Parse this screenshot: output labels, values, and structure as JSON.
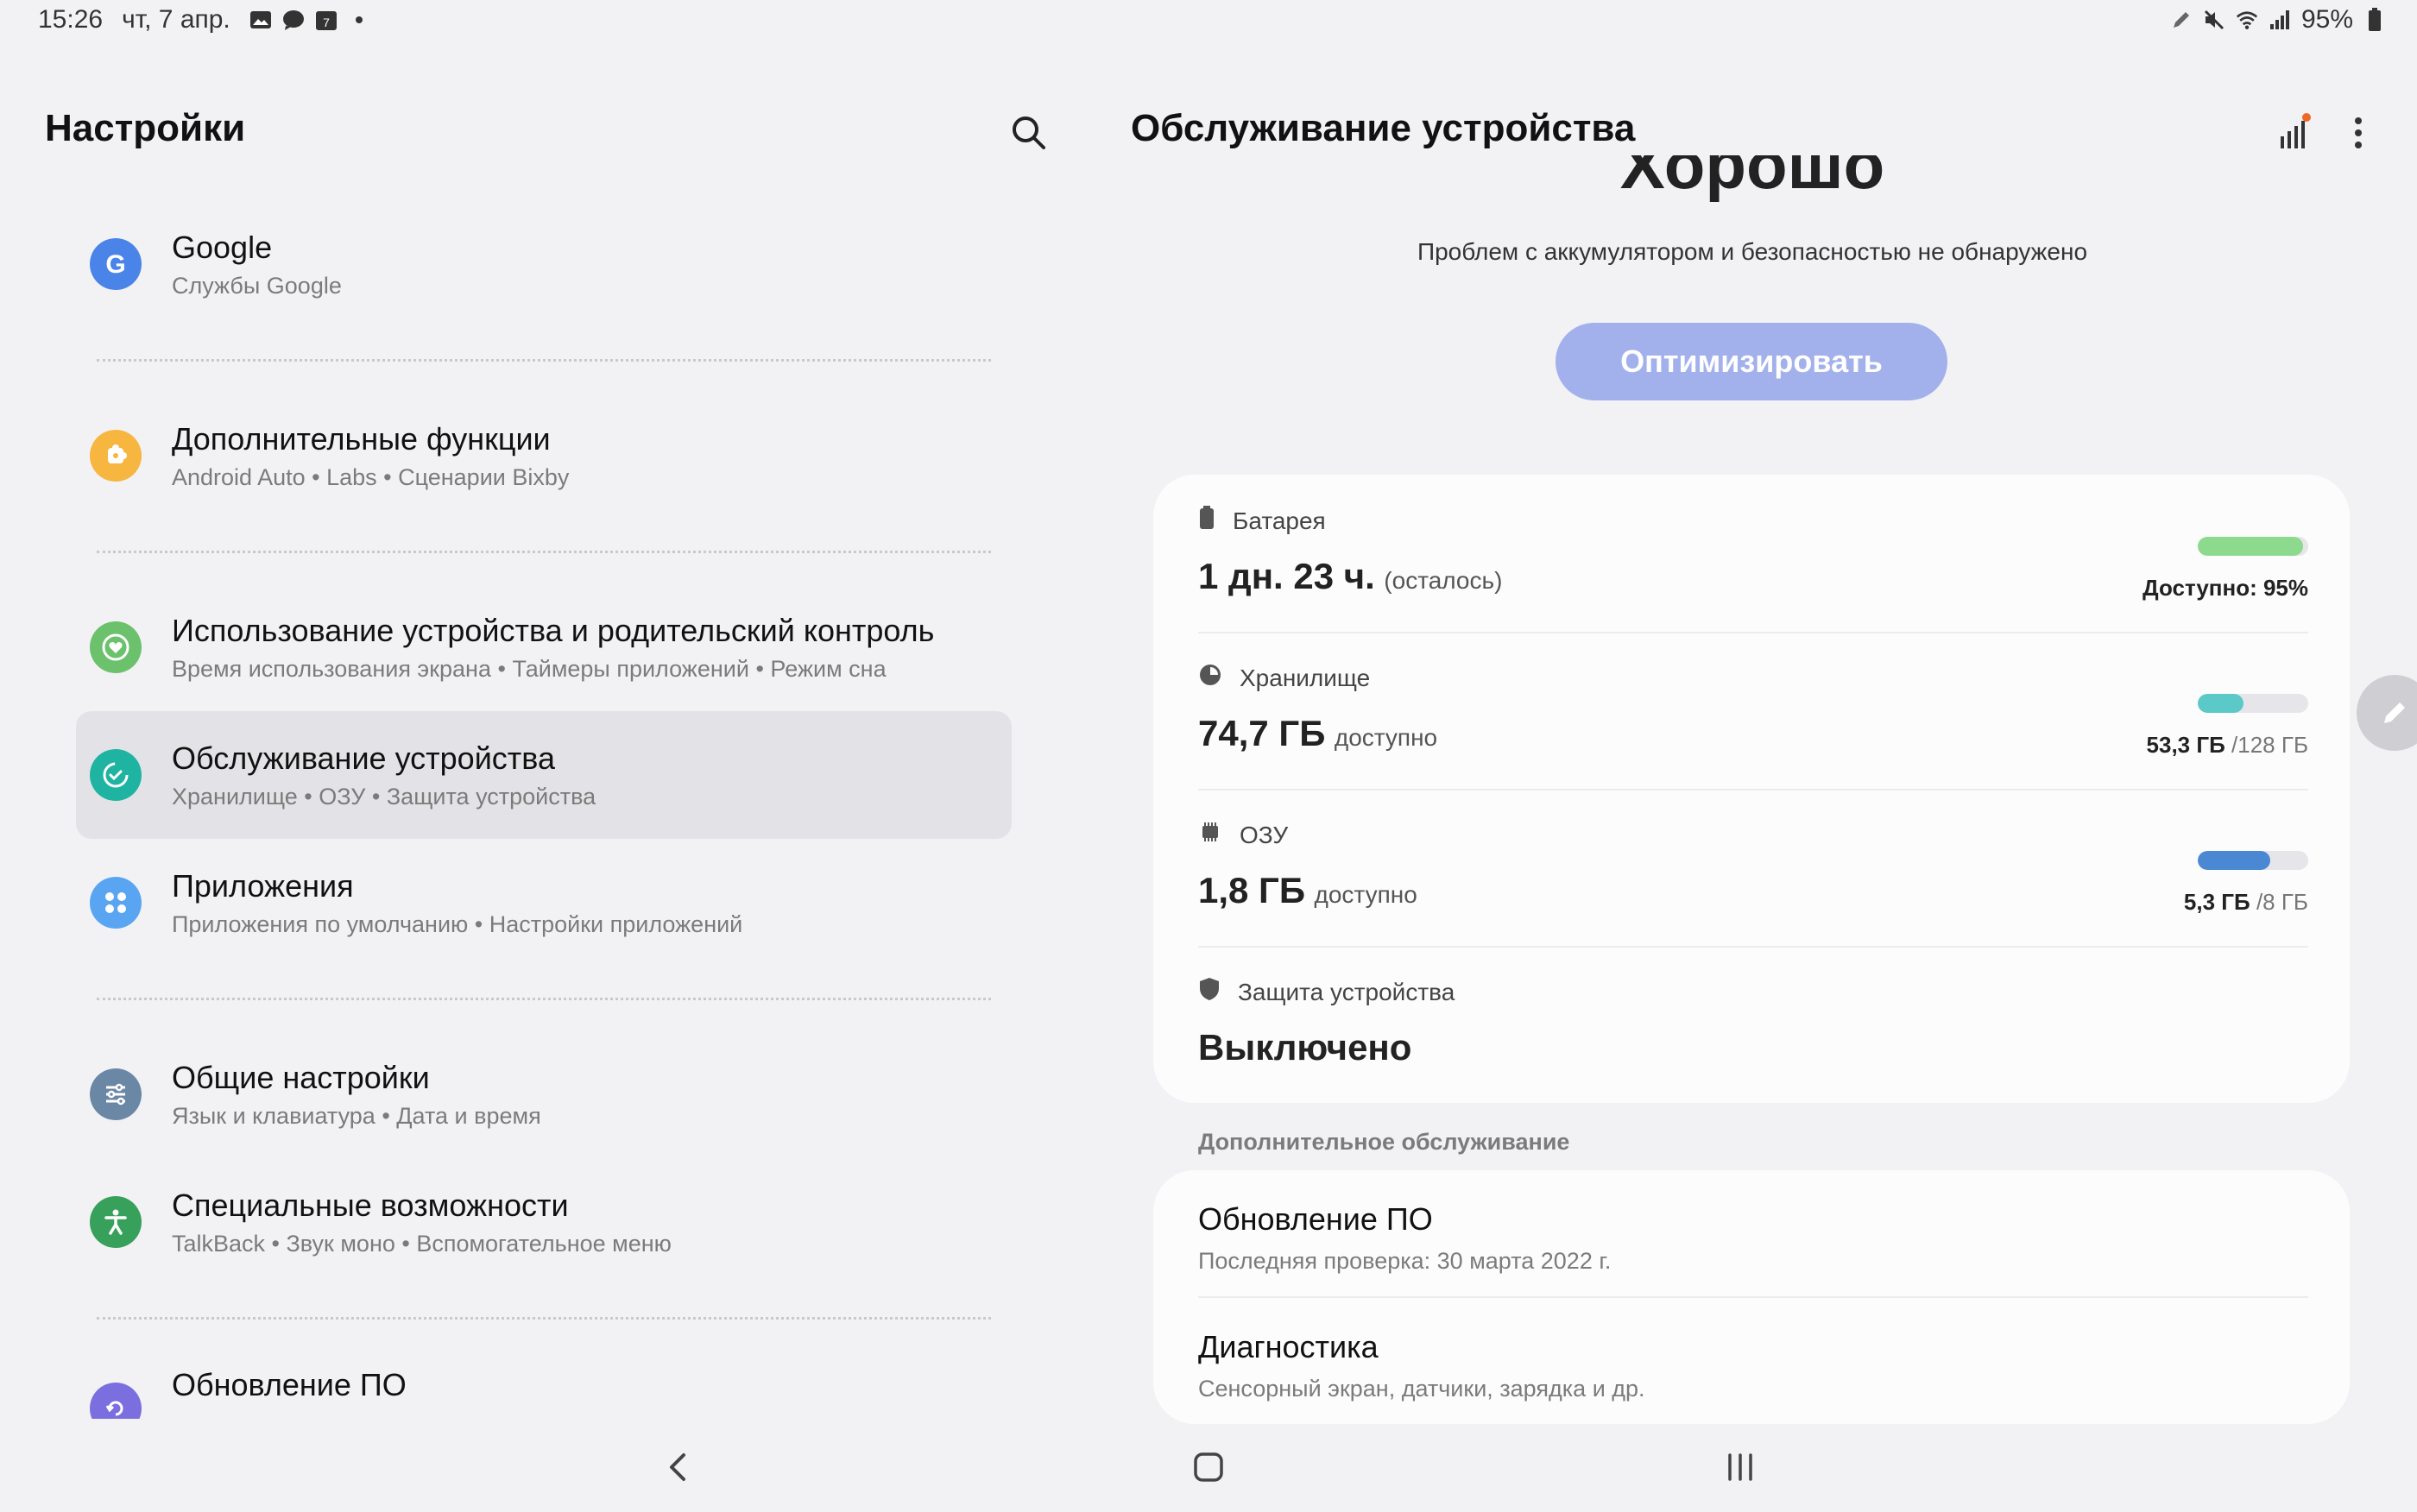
{
  "status_bar": {
    "time": "15:26",
    "date": "чт, 7 апр.",
    "battery": "95%",
    "left_icons": [
      "gallery-icon",
      "chat-icon",
      "calendar-icon",
      "dot-icon"
    ],
    "right_icons": [
      "pen-icon",
      "mute-icon",
      "wifi-icon",
      "signal-icon",
      "battery-icon"
    ]
  },
  "left": {
    "title": "Настройки",
    "items": [
      {
        "title": "Google",
        "subtitle": "Службы Google",
        "icon": "google-icon",
        "color": "#4a84e8"
      },
      {
        "title": "Дополнительные функции",
        "subtitle": "Android Auto  •  Labs  •  Сценарии Bixby",
        "icon": "puzzle-icon",
        "color": "#f6b640"
      },
      {
        "title": "Использование устройства и родительский контроль",
        "subtitle": "Время использования экрана  •  Таймеры приложений  •  Режим сна",
        "icon": "heart-icon",
        "color": "#6cc16c"
      },
      {
        "title": "Обслуживание устройства",
        "subtitle": "Хранилище  •  ОЗУ  •  Защита устройства",
        "icon": "care-icon",
        "color": "#1fb3a2"
      },
      {
        "title": "Приложения",
        "subtitle": "Приложения по умолчанию  •  Настройки приложений",
        "icon": "apps-icon",
        "color": "#5aa5f2"
      },
      {
        "title": "Общие настройки",
        "subtitle": "Язык и клавиатура  •  Дата и время",
        "icon": "sliders-icon",
        "color": "#6b87a6"
      },
      {
        "title": "Специальные возможности",
        "subtitle": "TalkBack  •  Звук моно  •  Вспомогательное меню",
        "icon": "accessibility-icon",
        "color": "#37a05a"
      },
      {
        "title": "Обновление ПО",
        "subtitle": "",
        "icon": "update-icon",
        "color": "#7b6fe0"
      }
    ]
  },
  "right": {
    "title": "Обслуживание устройства",
    "status_word": "Хорошо",
    "status_text": "Проблем с аккумулятором и безопасностью не обнаружено",
    "optimize_label": "Оптимизировать",
    "battery": {
      "label": "Батарея",
      "value": "1 дн. 23 ч.",
      "suffix": "(осталось)",
      "bar_label": "Доступно: 95%",
      "fraction": 0.95,
      "color": "#8dd98d"
    },
    "storage": {
      "label": "Хранилище",
      "value": "74,7 ГБ",
      "suffix": "доступно",
      "used": "53,3 ГБ",
      "total": "/128 ГБ",
      "fraction": 0.416,
      "color": "#5cc9c9"
    },
    "ram": {
      "label": "ОЗУ",
      "value": "1,8 ГБ",
      "suffix": "доступно",
      "used": "5,3 ГБ",
      "total": "/8 ГБ",
      "fraction": 0.66,
      "color": "#4a88d4"
    },
    "protection": {
      "label": "Защита устройства",
      "value": "Выключено"
    },
    "additional_label": "Дополнительное обслуживание",
    "extra": [
      {
        "title": "Обновление ПО",
        "subtitle": "Последняя проверка: 30 марта 2022 г."
      },
      {
        "title": "Диагностика",
        "subtitle": "Сенсорный экран, датчики, зарядка и др."
      }
    ]
  }
}
